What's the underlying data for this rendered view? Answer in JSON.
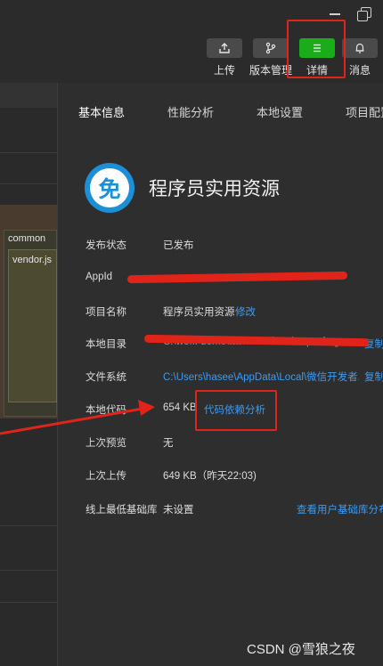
{
  "toolbar": {
    "buttons": [
      {
        "id": "upload",
        "label": "上传",
        "icon": "upload-icon"
      },
      {
        "id": "version",
        "label": "版本管理",
        "icon": "branch-icon"
      },
      {
        "id": "details",
        "label": "详情",
        "icon": "menu-icon",
        "highlight_color": "#1aad19"
      },
      {
        "id": "messages",
        "label": "消息",
        "icon": "bell-icon"
      }
    ]
  },
  "editor": {
    "folder_label": "common",
    "file_label": "vendor.js"
  },
  "tabs": [
    "基本信息",
    "性能分析",
    "本地设置",
    "项目配置"
  ],
  "app": {
    "logo_char": "免",
    "name": "程序员实用资源"
  },
  "info": {
    "publish_status": {
      "label": "发布状态",
      "value": "已发布"
    },
    "appid": {
      "label": "AppId"
    },
    "project_name": {
      "label": "项目名称",
      "value": "程序员实用资源",
      "action": "修改"
    },
    "local_dir": {
      "label": "本地目录",
      "value": "C:\\wo... demo\\task\\fila share\\unpackage...",
      "action": "复制"
    },
    "filesystem": {
      "label": "文件系统",
      "value": "C:\\Users\\hasee\\AppData\\Local\\微信开发者...",
      "action": "复制"
    },
    "local_code": {
      "label": "本地代码",
      "value": "654 KB",
      "action": "代码依赖分析"
    },
    "last_preview": {
      "label": "上次预览",
      "value": "无"
    },
    "last_upload": {
      "label": "上次上传",
      "value": "649 KB（昨天22:03)"
    },
    "min_lib": {
      "label": "线上最低基础库",
      "value": "未设置",
      "action": "查看用户基础库分布"
    }
  },
  "watermark": "CSDN @雪狼之夜",
  "colors": {
    "annotation_red": "#e0241a",
    "link_blue": "#3d9bf0",
    "accent_green": "#1aad19"
  }
}
